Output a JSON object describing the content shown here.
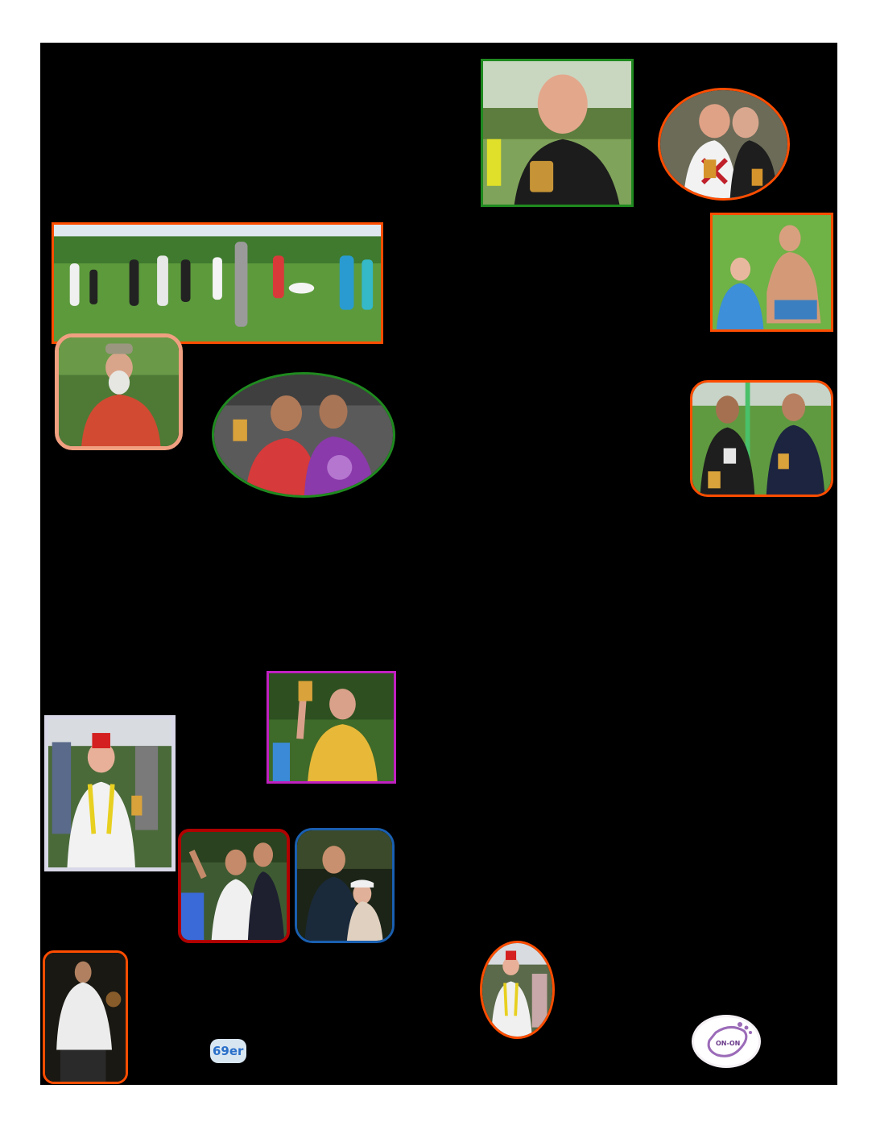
{
  "page": {
    "background": "#000000",
    "margin_color": "#ffffff"
  },
  "photos": [
    {
      "id": "beer-man-black-shirt",
      "frame_color": "#1f8a1f",
      "shape": "rect",
      "scene": "outdoor-trees"
    },
    {
      "id": "couple-union-jack",
      "frame_color": "#ff4d00",
      "shape": "oval",
      "scene": "street-night"
    },
    {
      "id": "group-field-circle",
      "frame_color": "#ff4d00",
      "shape": "rect",
      "scene": "grass-field"
    },
    {
      "id": "couple-on-grass",
      "frame_color": "#ff4d00",
      "shape": "rect",
      "scene": "grass-field"
    },
    {
      "id": "bearded-man-red-shirt",
      "frame_color": "#f0a080",
      "shape": "rounded",
      "scene": "outdoor-trees"
    },
    {
      "id": "two-women-beer",
      "frame_color": "#1f8a1f",
      "shape": "oval",
      "scene": "outdoor-crowd"
    },
    {
      "id": "two-men-japanese-shirt",
      "frame_color": "#ff4d00",
      "shape": "rounded",
      "scene": "grass-field"
    },
    {
      "id": "man-yellow-shirt-toast",
      "frame_color": "#c020c0",
      "shape": "rect",
      "scene": "outdoor-trees"
    },
    {
      "id": "man-red-fez",
      "frame_color": "#d8d8e8",
      "shape": "rect",
      "scene": "outdoor-crowd"
    },
    {
      "id": "two-men-toast",
      "frame_color": "#b00000",
      "shape": "rounded",
      "scene": "outdoor-crowd"
    },
    {
      "id": "couple-night-selfie",
      "frame_color": "#1a5fb0",
      "shape": "rounded",
      "scene": "night"
    },
    {
      "id": "man-white-tshirt-night",
      "frame_color": "#ff4d00",
      "shape": "rounded",
      "scene": "night"
    },
    {
      "id": "fez-man-small",
      "frame_color": "#ff4d00",
      "shape": "oval",
      "scene": "outdoor-crowd"
    }
  ],
  "logos": {
    "sixty_nine_er": "69er",
    "on_on_footprint": "ON-ON"
  }
}
